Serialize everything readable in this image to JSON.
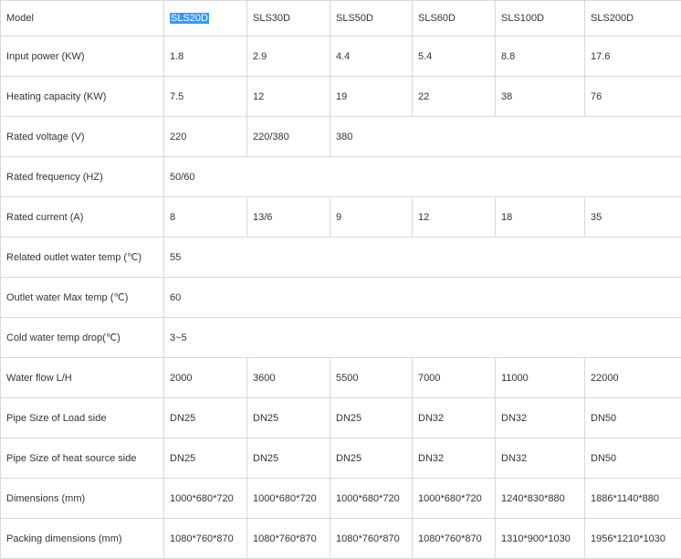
{
  "table": {
    "header": [
      "Model",
      "SLS20D",
      "SLS30D",
      "SLS50D",
      "SLS60D",
      "SLS100D",
      "SLS200D"
    ],
    "selected_text": "SLS20D",
    "rows": [
      [
        "Input power (KW)",
        "1.8",
        "2.9",
        "4.4",
        "5.4",
        "8.8",
        "17.6"
      ],
      [
        "Heating capacity (KW)",
        "7.5",
        "12",
        "19",
        "22",
        "38",
        "76"
      ],
      [
        "Rated voltage (V)",
        "220",
        "220/380",
        "380"
      ],
      [
        "Rated frequency (HZ)",
        "50/60"
      ],
      [
        "Rated current (A)",
        "8",
        "13/6",
        "9",
        "12",
        "18",
        "35"
      ],
      [
        "Related outlet water temp (℃)",
        "55"
      ],
      [
        "Outlet water Max temp (℃)",
        "60"
      ],
      [
        "Cold water temp drop(℃)",
        "3~5"
      ],
      [
        "Water flow L/H",
        "2000",
        "3600",
        "5500",
        "7000",
        "11000",
        "22000"
      ],
      [
        "Pipe Size of Load side",
        "DN25",
        "DN25",
        "DN25",
        "DN32",
        "DN32",
        "DN50"
      ],
      [
        "Pipe Size of heat source side",
        "DN25",
        "DN25",
        "DN25",
        "DN32",
        "DN32",
        "DN50"
      ],
      [
        "Dimensions (mm)",
        "1000*680*720",
        "1000*680*720",
        "1000*680*720",
        "1000*680*720",
        "1240*830*880",
        "1886*1140*880"
      ],
      [
        "Packing dimensions (mm)",
        "1080*760*870",
        "1080*760*870",
        "1080*760*870",
        "1080*760*870",
        "1310*900*1030",
        "1956*1210*1030"
      ]
    ]
  }
}
